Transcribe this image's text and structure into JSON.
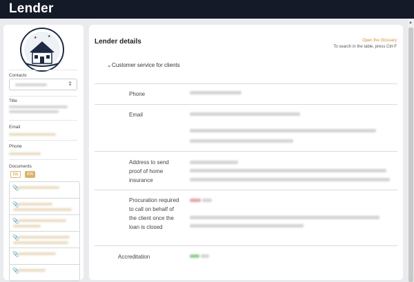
{
  "app": {
    "title": "Lender"
  },
  "sidebar": {
    "contacts_label": "Contacts",
    "title_label": "Title",
    "email_label": "Email",
    "phone_label": "Phone",
    "documents_label": "Documents",
    "lang_fr": "FR",
    "lang_en": "EN"
  },
  "main": {
    "heading": "Lender details",
    "glossary_link": "Open the Glossary",
    "search_hint": "To search in the table, press Ctrl-F",
    "section_title": "Customer service for clients",
    "fields": {
      "phone": "Phone",
      "email": "Email",
      "address": "Address to send proof of home insurance",
      "procuration": "Procuration required to call on behalf of the client once the loan is closed",
      "accreditation": "Accreditation"
    }
  },
  "icons": {
    "select_chevron": "chevron-updown-icon",
    "section_chevron": "chevron-down-icon",
    "doc": "paperclip-icon"
  }
}
